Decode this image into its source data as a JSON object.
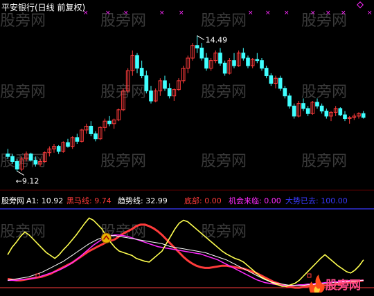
{
  "title": "平安银行(日线 前复权)",
  "watermark_text": "股旁网",
  "corner_logo_text": "股旁网",
  "colors": {
    "up": "#ff3b3b",
    "down": "#40ffff",
    "white": "#ffffff",
    "yellow": "#ffff50",
    "magenta": "#ff2aff",
    "gold": "#e6b400",
    "blue": "#3a3aff"
  },
  "chart_data": [
    {
      "type": "candlestick",
      "title": "平安银行(日线 前复权)",
      "ylim": [
        8.5,
        15.3
      ],
      "annotations": [
        {
          "label": "14.49",
          "value": 14.49,
          "marker": "high"
        },
        {
          "label": "9.12",
          "value": 9.12,
          "marker": "low"
        }
      ],
      "ohlc": [
        [
          9.8,
          10.0,
          9.6,
          9.7
        ],
        [
          9.7,
          9.8,
          9.4,
          9.5
        ],
        [
          9.5,
          9.6,
          9.1,
          9.2
        ],
        [
          9.2,
          9.7,
          9.12,
          9.6
        ],
        [
          9.6,
          9.9,
          9.5,
          9.8
        ],
        [
          9.8,
          9.85,
          9.5,
          9.55
        ],
        [
          9.55,
          9.7,
          9.3,
          9.4
        ],
        [
          9.4,
          9.6,
          9.3,
          9.5
        ],
        [
          9.5,
          9.9,
          9.45,
          9.85
        ],
        [
          9.85,
          10.1,
          9.7,
          10.0
        ],
        [
          10.0,
          10.2,
          9.85,
          10.1
        ],
        [
          10.1,
          10.15,
          9.8,
          9.9
        ],
        [
          9.9,
          10.3,
          9.85,
          10.25
        ],
        [
          10.25,
          10.4,
          10.05,
          10.1
        ],
        [
          10.1,
          10.5,
          10.0,
          10.45
        ],
        [
          10.45,
          10.6,
          10.2,
          10.3
        ],
        [
          10.3,
          10.8,
          10.25,
          10.75
        ],
        [
          10.75,
          11.0,
          10.6,
          10.9
        ],
        [
          10.9,
          11.1,
          10.5,
          10.6
        ],
        [
          10.6,
          10.7,
          10.3,
          10.4
        ],
        [
          10.4,
          10.9,
          10.35,
          10.85
        ],
        [
          10.85,
          11.2,
          10.7,
          11.1
        ],
        [
          11.1,
          11.3,
          10.9,
          11.0
        ],
        [
          11.0,
          11.2,
          10.8,
          11.15
        ],
        [
          11.15,
          11.6,
          11.1,
          11.55
        ],
        [
          11.55,
          12.4,
          11.5,
          12.3
        ],
        [
          12.3,
          13.2,
          12.2,
          13.1
        ],
        [
          13.1,
          13.9,
          12.9,
          13.7
        ],
        [
          13.7,
          13.8,
          13.0,
          13.2
        ],
        [
          13.2,
          13.5,
          12.8,
          12.9
        ],
        [
          12.9,
          13.1,
          12.2,
          12.3
        ],
        [
          12.3,
          12.5,
          11.8,
          11.9
        ],
        [
          11.9,
          12.4,
          11.85,
          12.3
        ],
        [
          12.3,
          12.8,
          12.1,
          12.7
        ],
        [
          12.7,
          12.9,
          12.3,
          12.4
        ],
        [
          12.4,
          12.6,
          12.0,
          12.1
        ],
        [
          12.1,
          12.4,
          11.9,
          12.35
        ],
        [
          12.35,
          12.8,
          12.3,
          12.7
        ],
        [
          12.7,
          13.3,
          12.6,
          13.2
        ],
        [
          13.2,
          13.7,
          13.0,
          13.6
        ],
        [
          13.6,
          14.2,
          13.5,
          14.1
        ],
        [
          14.1,
          14.49,
          13.8,
          14.0
        ],
        [
          14.0,
          14.2,
          13.5,
          13.6
        ],
        [
          13.6,
          13.8,
          13.1,
          13.2
        ],
        [
          13.2,
          13.6,
          13.1,
          13.5
        ],
        [
          13.5,
          13.9,
          13.4,
          13.8
        ],
        [
          13.8,
          14.0,
          13.3,
          13.4
        ],
        [
          13.4,
          13.5,
          12.9,
          13.0
        ],
        [
          13.0,
          13.6,
          12.95,
          13.5
        ],
        [
          13.5,
          13.8,
          13.2,
          13.3
        ],
        [
          13.3,
          13.9,
          13.25,
          13.8
        ],
        [
          13.8,
          14.0,
          13.5,
          13.6
        ],
        [
          13.6,
          13.7,
          13.2,
          13.3
        ],
        [
          13.3,
          13.6,
          13.2,
          13.55
        ],
        [
          13.55,
          13.8,
          13.4,
          13.5
        ],
        [
          13.5,
          13.6,
          13.1,
          13.2
        ],
        [
          13.2,
          13.3,
          12.8,
          12.9
        ],
        [
          12.9,
          13.0,
          12.5,
          12.6
        ],
        [
          12.6,
          12.9,
          12.4,
          12.8
        ],
        [
          12.8,
          12.9,
          12.3,
          12.4
        ],
        [
          12.4,
          12.5,
          12.0,
          12.1
        ],
        [
          12.1,
          12.2,
          11.6,
          11.7
        ],
        [
          11.7,
          11.8,
          11.2,
          11.3
        ],
        [
          11.3,
          11.9,
          11.25,
          11.8
        ],
        [
          11.8,
          12.0,
          11.5,
          11.6
        ],
        [
          11.6,
          11.7,
          11.3,
          11.4
        ],
        [
          11.4,
          11.9,
          11.35,
          11.85
        ],
        [
          11.85,
          12.0,
          11.6,
          11.7
        ],
        [
          11.7,
          11.8,
          11.4,
          11.5
        ],
        [
          11.5,
          11.6,
          11.2,
          11.3
        ],
        [
          11.3,
          11.5,
          11.1,
          11.45
        ],
        [
          11.45,
          11.7,
          11.3,
          11.6
        ],
        [
          11.6,
          11.65,
          11.3,
          11.35
        ],
        [
          11.35,
          11.5,
          11.1,
          11.2
        ],
        [
          11.2,
          11.3,
          11.0,
          11.25
        ],
        [
          11.25,
          11.4,
          11.15,
          11.3
        ],
        [
          11.3,
          11.45,
          11.2,
          11.4
        ],
        [
          11.4,
          11.5,
          11.2,
          11.25
        ]
      ]
    },
    {
      "type": "line",
      "series": [
        {
          "name": "黑马线",
          "values": [
            12,
            11,
            10,
            10,
            11,
            12,
            13,
            14,
            15,
            17,
            19,
            22,
            25,
            28,
            31,
            34,
            38,
            42,
            46,
            50,
            53,
            56,
            59,
            62,
            64,
            66,
            70,
            74,
            77,
            80,
            84,
            86,
            86,
            84,
            81,
            77,
            72,
            66,
            60,
            54,
            48,
            42,
            37,
            33,
            30,
            28,
            27,
            27,
            28,
            29,
            30,
            30,
            29,
            28,
            27,
            26,
            24,
            22,
            20,
            17,
            14,
            11,
            8,
            6,
            4,
            2,
            1,
            0,
            0,
            1,
            2,
            3,
            4,
            4,
            3,
            3,
            4,
            5,
            6,
            7,
            7,
            8,
            9,
            10
          ]
        },
        {
          "name": "趋势线",
          "values": [
            10,
            10,
            10,
            11,
            11,
            12,
            13,
            14,
            16,
            18,
            20,
            22,
            24,
            27,
            30,
            34,
            38,
            43,
            48,
            53,
            58,
            62,
            66,
            69,
            71,
            72,
            72,
            71,
            70,
            68,
            66,
            64,
            62,
            60,
            58,
            56,
            55,
            54,
            53,
            52,
            51,
            50,
            49,
            48,
            47,
            46,
            44,
            42,
            40,
            38,
            35,
            32,
            29,
            26,
            23,
            20,
            17,
            14,
            11,
            9,
            7,
            6,
            5,
            4,
            3,
            3,
            3,
            3,
            4,
            4,
            5,
            5,
            6,
            6,
            7,
            7,
            8,
            8,
            9,
            9,
            10,
            10,
            10,
            10
          ]
        },
        {
          "name": "A1",
          "values": [
            45,
            55,
            62,
            70,
            76,
            72,
            66,
            60,
            54,
            48,
            44,
            40,
            45,
            52,
            58,
            65,
            72,
            80,
            88,
            95,
            92,
            86,
            80,
            70,
            62,
            55,
            50,
            48,
            46,
            44,
            40,
            38,
            36,
            35,
            40,
            45,
            50,
            60,
            70,
            80,
            88,
            92,
            90,
            85,
            80,
            75,
            70,
            65,
            60,
            55,
            50,
            46,
            43,
            40,
            38,
            35,
            30,
            25,
            20,
            15,
            12,
            9,
            6,
            4,
            2,
            2,
            4,
            6,
            10,
            16,
            22,
            28,
            34,
            40,
            45,
            40,
            35,
            30,
            26,
            22,
            20,
            24,
            30,
            38
          ]
        },
        {
          "name": "白线",
          "values": [
            10,
            11,
            12,
            13,
            14,
            15,
            17,
            19,
            21,
            24,
            27,
            30,
            33,
            36,
            40,
            44,
            48,
            52,
            56,
            60,
            63,
            66,
            68,
            70,
            71,
            71,
            70,
            69,
            68,
            67,
            66,
            65,
            64,
            63,
            62,
            61,
            60,
            58,
            56,
            55,
            54,
            53,
            52,
            51,
            50,
            49,
            48,
            46,
            44,
            42,
            40,
            38,
            35,
            32,
            29,
            26,
            23,
            20,
            17,
            14,
            11,
            9,
            7,
            6,
            5,
            4,
            3,
            3,
            3,
            3,
            4,
            4,
            5,
            5,
            6,
            6,
            7,
            7,
            8,
            8,
            9,
            9,
            10,
            10
          ]
        }
      ]
    }
  ],
  "indicator_legend": [
    {
      "label": "A1: 10.92",
      "color": "#ffffff"
    },
    {
      "label": "黑马线: 9.74",
      "color": "#ff3b3b"
    },
    {
      "label": "趋势线: 32.99",
      "color": "#ffffff"
    },
    {
      "label": "底部: 0.00",
      "color": "#ff3b3b"
    },
    {
      "label": "机会来临: 0.00",
      "color": "#ff2aff"
    },
    {
      "label": "大势已去: 100.00",
      "color": "#3a3aff"
    }
  ]
}
